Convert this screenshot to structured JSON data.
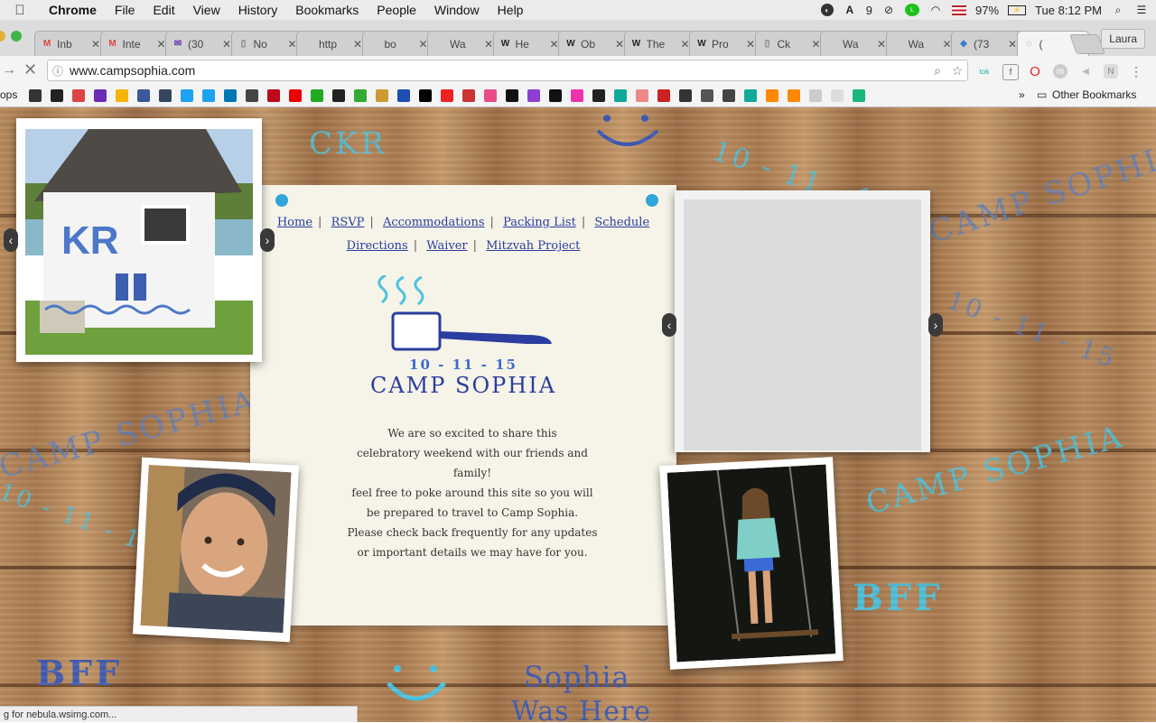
{
  "menubar": {
    "app_name": "Chrome",
    "items": [
      "File",
      "Edit",
      "View",
      "History",
      "Bookmarks",
      "People",
      "Window",
      "Help"
    ],
    "status": {
      "notifications": "9",
      "battery": "97%",
      "clock": "Tue 8:12 PM"
    }
  },
  "tabs": [
    {
      "fav": "M",
      "label": "Inb"
    },
    {
      "fav": "M",
      "label": "Inte"
    },
    {
      "fav": "✉",
      "label": "(30"
    },
    {
      "fav": "▯",
      "label": "No"
    },
    {
      "fav": "",
      "label": "http"
    },
    {
      "fav": "",
      "label": "bo"
    },
    {
      "fav": "",
      "label": "Wa"
    },
    {
      "fav": "W",
      "label": "He"
    },
    {
      "fav": "W",
      "label": "Ob"
    },
    {
      "fav": "W",
      "label": "The"
    },
    {
      "fav": "W",
      "label": "Pro"
    },
    {
      "fav": "▯",
      "label": "Ck"
    },
    {
      "fav": "",
      "label": "Wa"
    },
    {
      "fav": "",
      "label": "Wa"
    },
    {
      "fav": "◆",
      "label": "(73"
    },
    {
      "fav": "◌",
      "label": "("
    }
  ],
  "profile": "Laura",
  "address": {
    "url": "www.campsophia.com"
  },
  "bookmarks": {
    "apps_label": "ops",
    "other": "Other Bookmarks",
    "overflow": "»"
  },
  "site": {
    "nav_row1": [
      "Home",
      "RSVP",
      "Accommodations",
      "Packing List",
      "Schedule"
    ],
    "nav_row2": [
      "Directions",
      "Waiver",
      "Mitzvah Project"
    ],
    "date": "10 - 11 - 15",
    "title": "CAMP SOPHIA",
    "intro": [
      "We are so excited to share this",
      "celebratory weekend with our friends and family!",
      "feel free to poke around this site so you will",
      "be prepared to travel to Camp Sophia.",
      "Please check back frequently for any updates",
      "or important details we may have for you."
    ],
    "cabin_sign": "KR"
  },
  "scribbles": {
    "ckr": "CKR",
    "date1": "10 - 11 - 15",
    "camp1": "CAMP SOPHIA",
    "camp2": "CAMP SOPHIA",
    "camp3": "CAMP SOPHIA",
    "date2": "10 - 11 - 15",
    "date3": "10 - 11 - 15",
    "bff1": "BFF",
    "bff2": "BFF",
    "sophia": "Sophia",
    "was_here": "Was Here"
  },
  "status_bar": "g for nebula.wsimg.com..."
}
